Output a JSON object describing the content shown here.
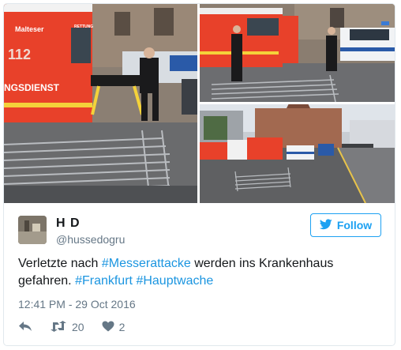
{
  "user": {
    "name": "H D",
    "handle": "@hussedogru"
  },
  "follow_label": "Follow",
  "tweet": {
    "part1": "Verletzte nach ",
    "hashtag1": "#Messerattacke",
    "part2": " werden ins Krankenhaus gefahren. ",
    "hashtag2": "#Frankfurt",
    "space": " ",
    "hashtag3": "#Hauptwache"
  },
  "timestamp": "12:41 PM - 29 Oct 2016",
  "actions": {
    "retweet_count": "20",
    "like_count": "2"
  },
  "photo_text": {
    "malteser": "Malteser",
    "number": "112",
    "rettung": "RETTUNG",
    "dienst": "NGSDIENST"
  },
  "colors": {
    "accent": "#1da1f2",
    "hashtag": "#1b95e0",
    "ambulance": "#e8412a"
  }
}
